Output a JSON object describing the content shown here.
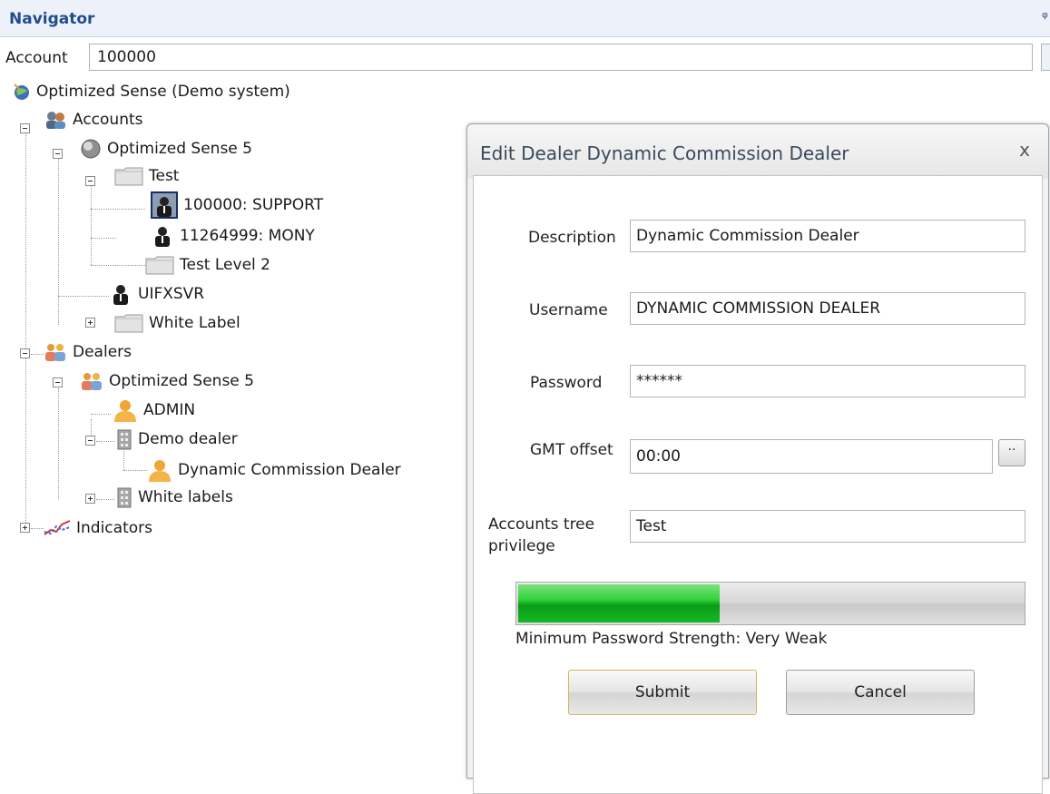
{
  "navigator": {
    "title": "Navigator",
    "account_label": "Account",
    "account_value": "100000"
  },
  "tree": {
    "root": "Optimized Sense (Demo system)",
    "accounts": "Accounts",
    "accounts_server": "Optimized Sense 5",
    "test_group": "Test",
    "account_1": "100000: SUPPORT",
    "account_2": "11264999: MONY",
    "test_level2": "Test Level 2",
    "uifxsvr": "UIFXSVR",
    "white_label": "White Label",
    "dealers": "Dealers",
    "dealers_server": "Optimized Sense 5",
    "admin": "ADMIN",
    "demo_dealer": "Demo dealer",
    "dyn_dealer": "Dynamic Commission Dealer",
    "white_labels": "White labels",
    "indicators": "Indicators"
  },
  "dialog": {
    "title": "Edit Dealer Dynamic Commission Dealer",
    "close": "x",
    "description_label": "Description",
    "description_value": "Dynamic Commission Dealer",
    "username_label": "Username",
    "username_value": "DYNAMIC COMMISSION DEALER",
    "password_label": "Password",
    "password_value": "******",
    "gmt_label": "GMT offset",
    "gmt_value": "00:00",
    "gmt_button": "··",
    "tree_priv_label_line1": "Accounts tree",
    "tree_priv_label_line2": "privilege",
    "tree_priv_value": "Test",
    "strength_fraction": 0.4,
    "strength_text": "Minimum Password Strength: Very Weak",
    "submit": "Submit",
    "cancel": "Cancel"
  }
}
